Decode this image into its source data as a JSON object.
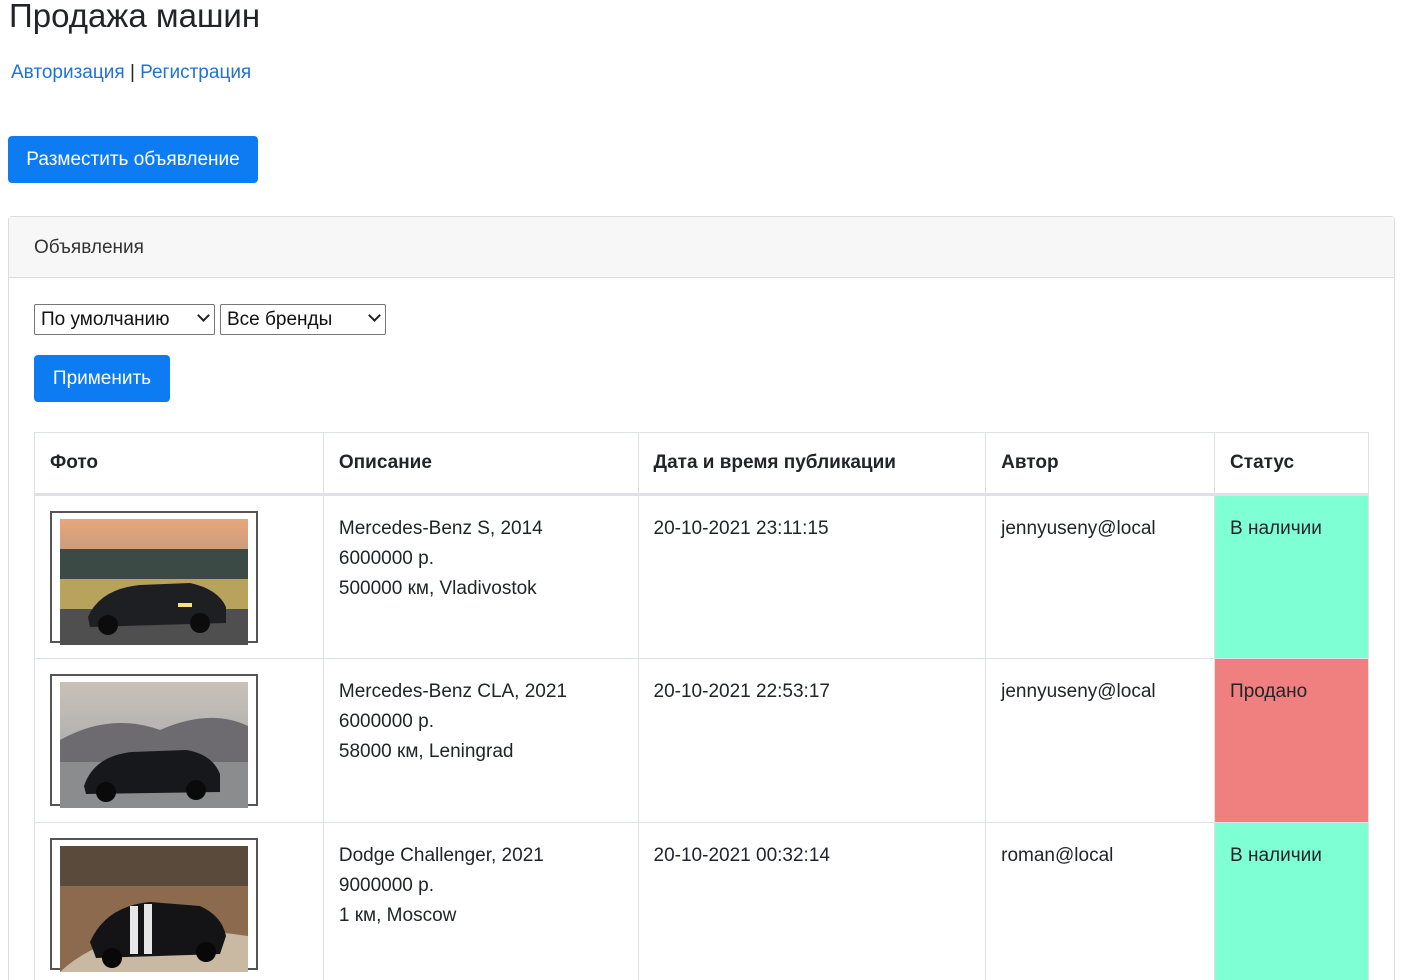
{
  "header": {
    "title": "Продажа машин"
  },
  "auth": {
    "login": "Авторизация",
    "separator": "|",
    "register": "Регистрация"
  },
  "post_button": "Разместить объявление",
  "card": {
    "title": "Объявления",
    "filters": {
      "sort_selected": "По умолчанию",
      "brand_selected": "Все бренды"
    },
    "apply_button": "Применить"
  },
  "table": {
    "columns": [
      "Фото",
      "Описание",
      "Дата и время публикации",
      "Автор",
      "Статус"
    ],
    "rows": [
      {
        "photo_icon": "car-photo-icon",
        "desc_line1": "Mercedes-Benz S, 2014",
        "desc_line2": "6000000 р.",
        "desc_line3": "500000 км, Vladivostok",
        "date": "20-10-2021 23:11:15",
        "author": "jennyuseny@local",
        "status": "В наличии",
        "status_color": "#7fffd4"
      },
      {
        "photo_icon": "car-photo-icon",
        "desc_line1": "Mercedes-Benz CLA, 2021",
        "desc_line2": "6000000 р.",
        "desc_line3": "58000 км, Leningrad",
        "date": "20-10-2021 22:53:17",
        "author": "jennyuseny@local",
        "status": "Продано",
        "status_color": "#f08080"
      },
      {
        "photo_icon": "car-photo-icon",
        "desc_line1": "Dodge Challenger, 2021",
        "desc_line2": "9000000 р.",
        "desc_line3": "1 км, Moscow",
        "date": "20-10-2021 00:32:14",
        "author": "roman@local",
        "status": "В наличии",
        "status_color": "#7fffd4"
      }
    ]
  },
  "colors": {
    "primary": "#0d7cf2",
    "link": "#1f72d6",
    "available": "#7fffd4",
    "sold": "#f08080"
  }
}
